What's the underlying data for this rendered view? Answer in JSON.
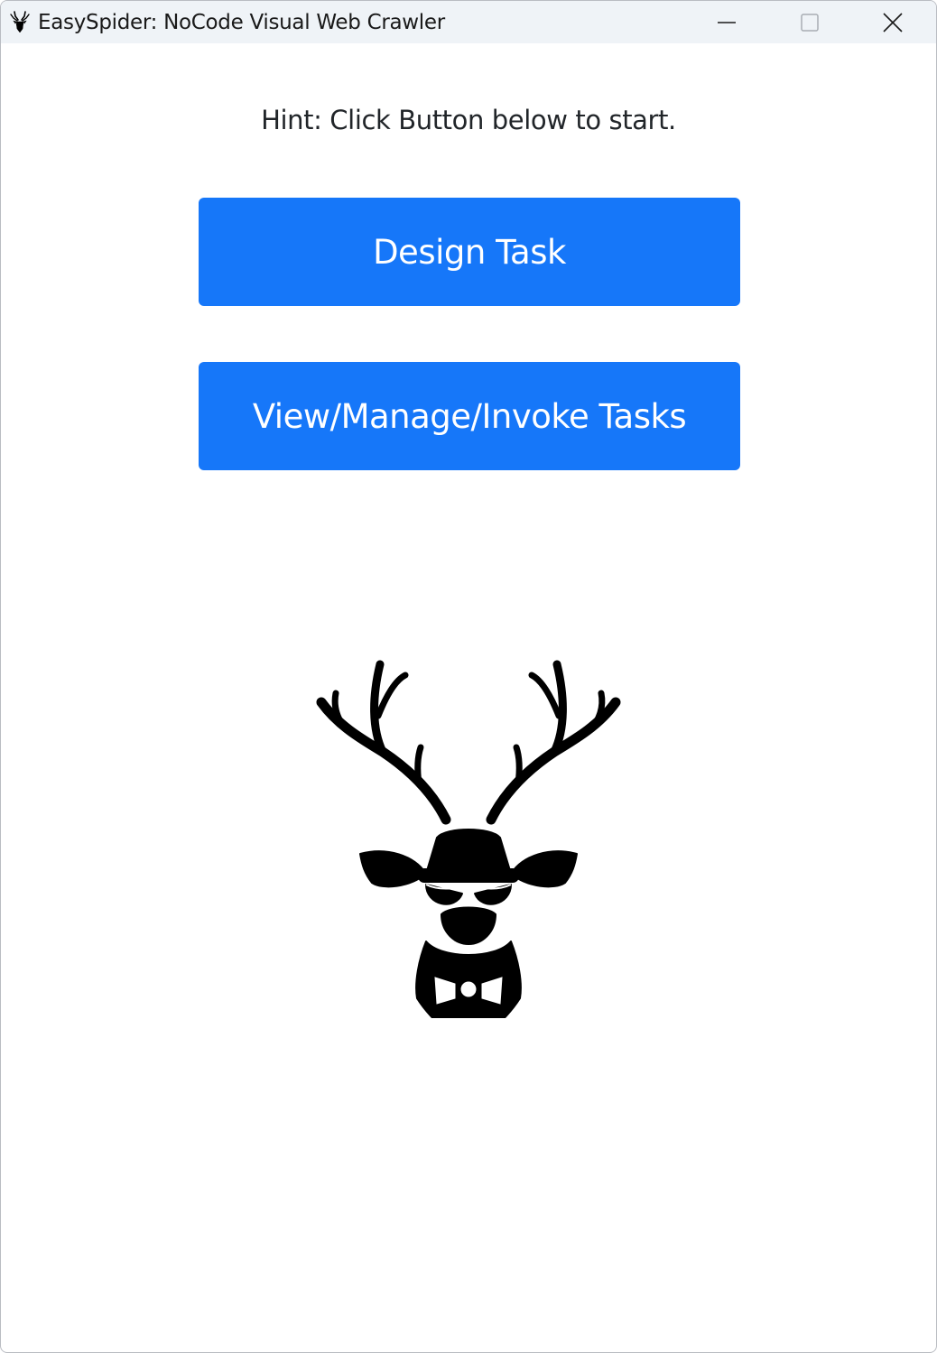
{
  "window": {
    "title": "EasySpider: NoCode Visual Web Crawler",
    "app_icon": "deer-logo-icon",
    "controls": [
      "minimize-icon",
      "maximize-icon",
      "close-icon"
    ]
  },
  "main": {
    "hint": "Hint: Click Button below to start.",
    "design_button_label": "Design Task",
    "manage_button_label": "View/Manage/Invoke Tasks",
    "logo": "deer-head-logo"
  },
  "colors": {
    "primary_button": "#1677f9",
    "titlebar": "#eff3f7",
    "text": "#212529"
  }
}
